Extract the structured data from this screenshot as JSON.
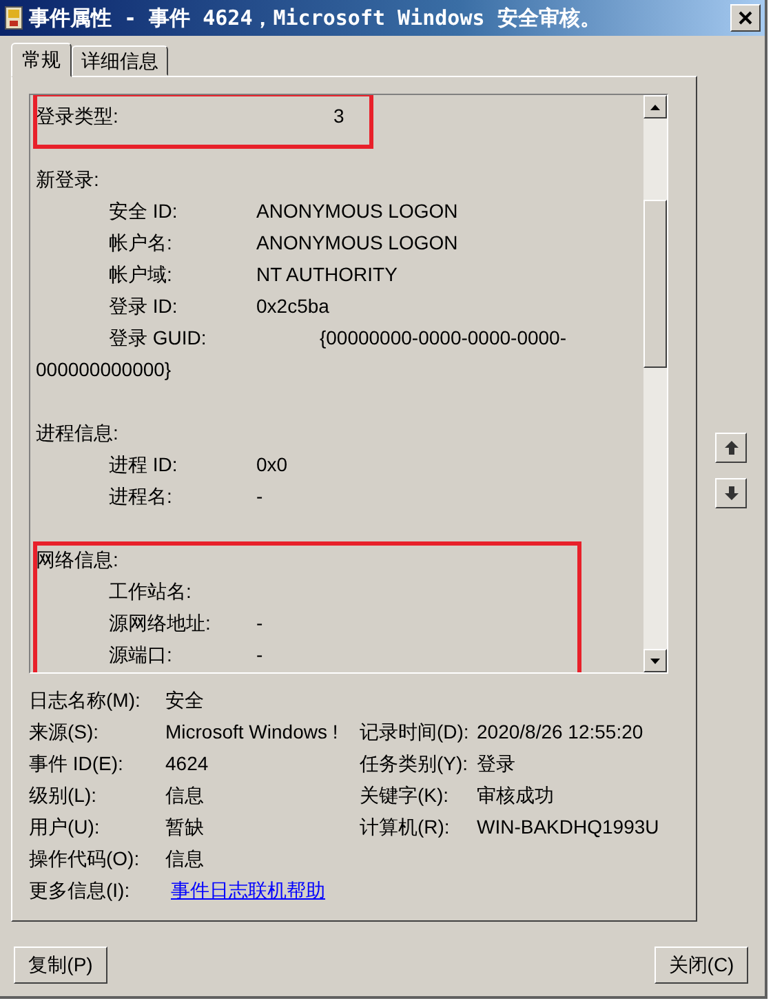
{
  "window": {
    "title": "事件属性 - 事件 4624，Microsoft Windows 安全审核。"
  },
  "tabs": [
    {
      "label": "常规",
      "selected": true
    },
    {
      "label": "详细信息",
      "selected": false
    }
  ],
  "description": {
    "sections": [
      {
        "heading": "登录类型:",
        "value": "3",
        "highlighted": true
      },
      {
        "heading": "新登录:",
        "highlighted": false,
        "items": [
          {
            "label": "安全 ID:",
            "value": "ANONYMOUS LOGON"
          },
          {
            "label": "帐户名:",
            "value": "ANONYMOUS LOGON"
          },
          {
            "label": "帐户域:",
            "value": "NT AUTHORITY"
          },
          {
            "label": "登录 ID:",
            "value": "0x2c5ba"
          },
          {
            "label": "登录 GUID:",
            "value": "{00000000-0000-0000-0000-",
            "value_continued": "000000000000}"
          }
        ]
      },
      {
        "heading": "进程信息:",
        "highlighted": false,
        "items": [
          {
            "label": "进程 ID:",
            "value": "0x0"
          },
          {
            "label": "进程名:",
            "value": "-"
          }
        ]
      },
      {
        "heading": "网络信息:",
        "highlighted": true,
        "items": [
          {
            "label": "工作站名:"
          },
          {
            "label": "源网络地址:",
            "value": "-"
          },
          {
            "label": "源端口:",
            "value": "-"
          }
        ]
      }
    ]
  },
  "fields": [
    [
      {
        "label": "日志名称(M):",
        "value": "安全"
      }
    ],
    [
      {
        "label": "来源(S):",
        "value": "Microsoft Windows !"
      },
      {
        "label": "记录时间(D):",
        "value": "2020/8/26 12:55:20"
      }
    ],
    [
      {
        "label": "事件 ID(E):",
        "value": "4624"
      },
      {
        "label": "任务类别(Y):",
        "value": "登录"
      }
    ],
    [
      {
        "label": "级别(L):",
        "value": "信息"
      },
      {
        "label": "关键字(K):",
        "value": "审核成功"
      }
    ],
    [
      {
        "label": "用户(U):",
        "value": "暂缺"
      },
      {
        "label": "计算机(R):",
        "value": "WIN-BAKDHQ1993U"
      }
    ],
    [
      {
        "label": "操作代码(O):",
        "value": "信息"
      }
    ],
    [
      {
        "label": "更多信息(I):",
        "value": "事件日志联机帮助",
        "kind": "link"
      }
    ]
  ],
  "buttons": [
    {
      "label": "复制(P)"
    },
    {
      "label": "关闭(C)"
    }
  ]
}
